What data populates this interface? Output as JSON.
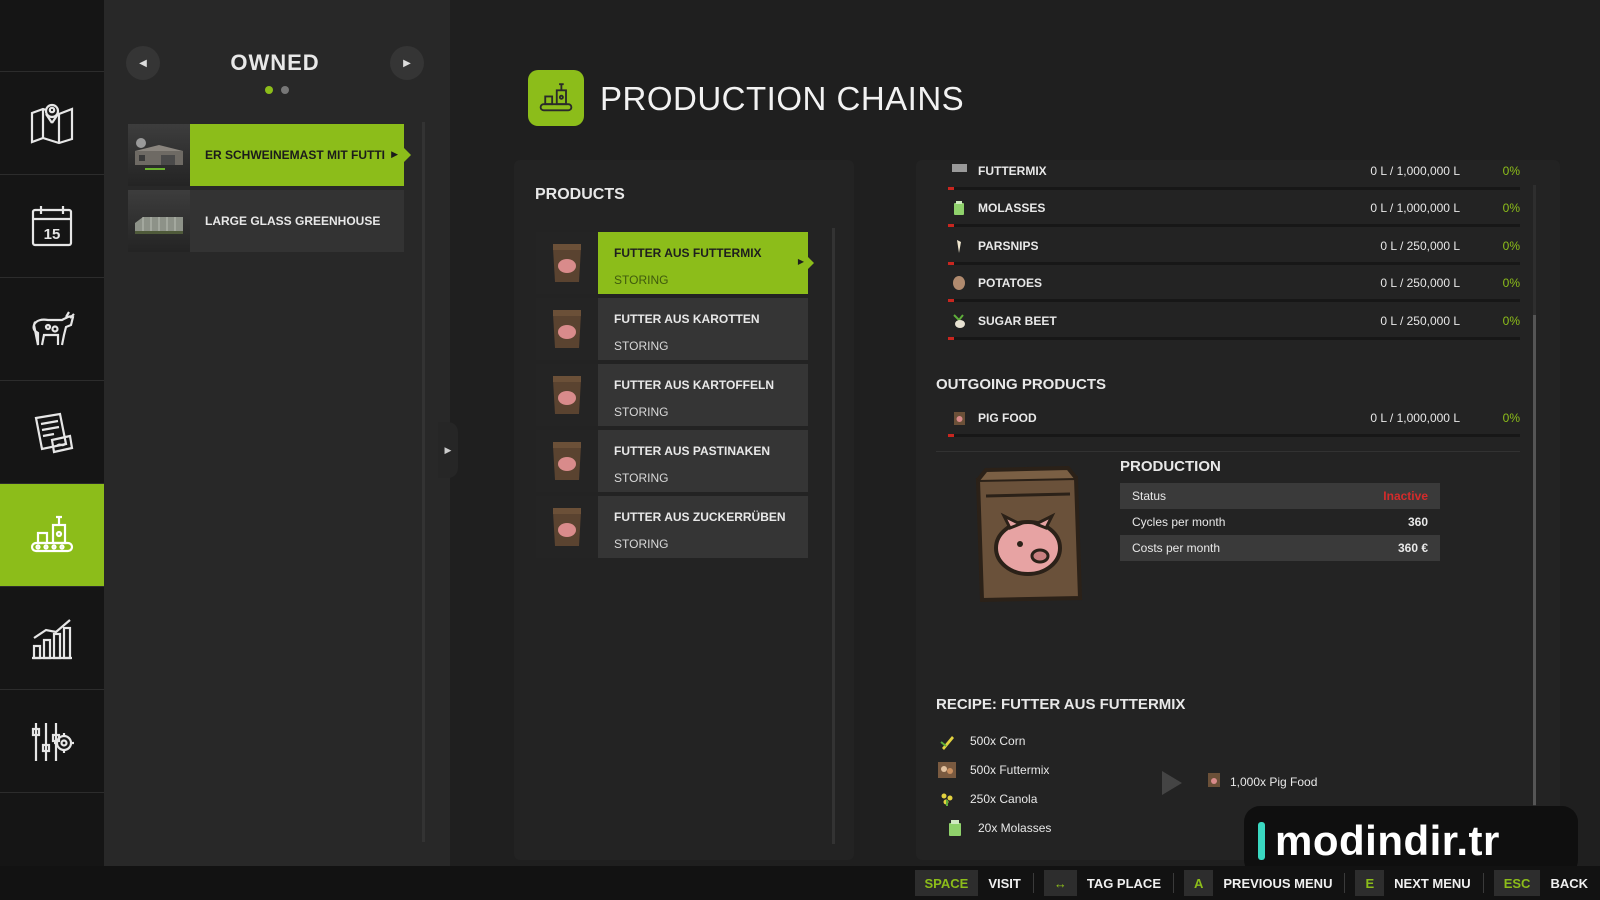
{
  "nav": {
    "items": [
      {
        "name": "map",
        "icon": "map-pin-icon"
      },
      {
        "name": "calendar",
        "icon": "calendar-icon",
        "label": "15"
      },
      {
        "name": "animals",
        "icon": "cow-icon"
      },
      {
        "name": "contracts",
        "icon": "document-icon"
      },
      {
        "name": "production",
        "icon": "factory-icon",
        "active": true
      },
      {
        "name": "statistics",
        "icon": "bar-chart-icon"
      },
      {
        "name": "settings",
        "icon": "settings-sliders-icon"
      }
    ]
  },
  "owned": {
    "title": "OWNED",
    "page": 1,
    "pages": 2,
    "items": [
      {
        "label": "ER SCHWEINEMAST MIT FUTTI",
        "active": true
      },
      {
        "label": "LARGE GLASS GREENHOUSE",
        "active": false
      }
    ]
  },
  "header": {
    "title": "PRODUCTION CHAINS"
  },
  "products": {
    "title": "PRODUCTS",
    "items": [
      {
        "name": "FUTTER AUS FUTTERMIX",
        "status": "STORING",
        "active": true
      },
      {
        "name": "FUTTER AUS KAROTTEN",
        "status": "STORING"
      },
      {
        "name": "FUTTER AUS KARTOFFELN",
        "status": "STORING"
      },
      {
        "name": "FUTTER AUS PASTINAKEN",
        "status": "STORING"
      },
      {
        "name": "FUTTER AUS ZUCKERRÜBEN",
        "status": "STORING"
      }
    ]
  },
  "details": {
    "incoming": [
      {
        "name": "FUTTERMIX",
        "amount": "0 L / 1,000,000 L",
        "percent": "0%",
        "fill": 0
      },
      {
        "name": "MOLASSES",
        "amount": "0 L / 1,000,000 L",
        "percent": "0%",
        "fill": 0
      },
      {
        "name": "PARSNIPS",
        "amount": "0 L / 250,000 L",
        "percent": "0%",
        "fill": 0
      },
      {
        "name": "POTATOES",
        "amount": "0 L / 250,000 L",
        "percent": "0%",
        "fill": 0
      },
      {
        "name": "SUGAR BEET",
        "amount": "0 L / 250,000 L",
        "percent": "0%",
        "fill": 0
      }
    ],
    "outgoing_title": "OUTGOING PRODUCTS",
    "outgoing": [
      {
        "name": "PIG FOOD",
        "amount": "0 L / 1,000,000 L",
        "percent": "0%",
        "fill": 0
      }
    ],
    "production": {
      "title": "PRODUCTION",
      "status_label": "Status",
      "status_value": "Inactive",
      "cycles_label": "Cycles per month",
      "cycles_value": "360",
      "costs_label": "Costs per month",
      "costs_value": "360 €"
    },
    "recipe": {
      "title": "RECIPE: FUTTER AUS FUTTERMIX",
      "inputs": [
        "500x Corn",
        "500x Futtermix",
        "250x Canola",
        "20x Molasses"
      ],
      "output": "1,000x Pig Food"
    }
  },
  "watermark": "modindir.tr",
  "footer": {
    "actions": [
      {
        "key": "SPACE",
        "label": "VISIT"
      },
      {
        "key": "↔",
        "label": "TAG PLACE"
      },
      {
        "key": "A",
        "label": "PREVIOUS MENU"
      },
      {
        "key": "E",
        "label": "NEXT MENU"
      },
      {
        "key": "ESC",
        "label": "BACK"
      }
    ]
  },
  "colors": {
    "accent": "#8cbd1a",
    "danger": "#d52b2b",
    "background": "#1f1f1f"
  }
}
